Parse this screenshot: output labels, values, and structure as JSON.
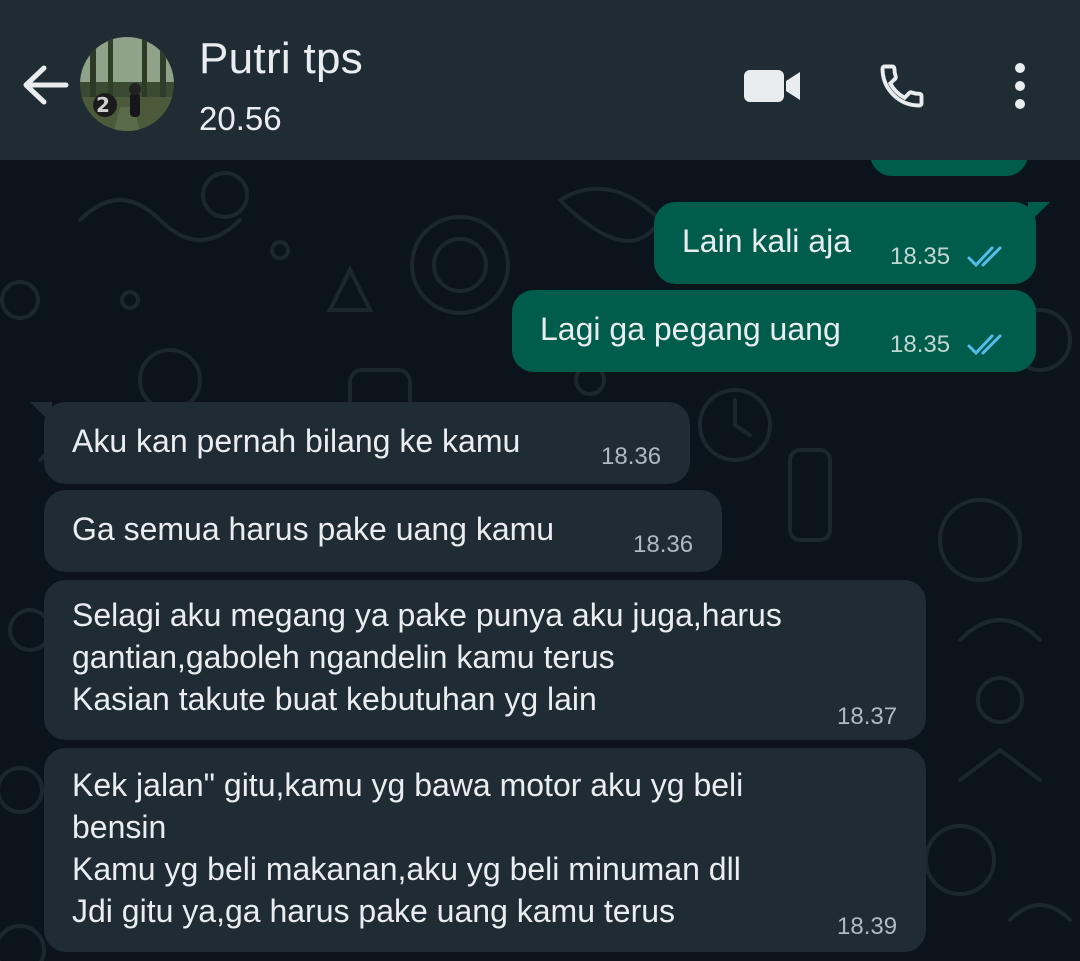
{
  "colors": {
    "header_bg": "#1f2c34",
    "chat_bg": "#0b141a",
    "outgoing_bubble": "#005c4b",
    "incoming_bubble": "#1f2c34",
    "read_ticks": "#53bdeb"
  },
  "header": {
    "contact_name": "Putri tps",
    "status": "20.56",
    "icons": [
      "back-arrow-icon",
      "avatar",
      "video-call-icon",
      "phone-icon",
      "more-vertical-icon"
    ]
  },
  "messages": [
    {
      "direction": "out",
      "text": "Lain kali aja",
      "time": "18.35",
      "status": "read"
    },
    {
      "direction": "out",
      "text": "Lagi ga pegang uang",
      "time": "18.35",
      "status": "read"
    },
    {
      "direction": "in",
      "text": "Aku kan pernah bilang ke kamu",
      "time": "18.36"
    },
    {
      "direction": "in",
      "text": "Ga semua harus pake uang kamu",
      "time": "18.36"
    },
    {
      "direction": "in",
      "text": "Selagi aku megang ya pake punya aku juga,harus\ngantian,gaboleh ngandelin kamu terus\nKasian takute buat kebutuhan yg lain",
      "time": "18.37"
    },
    {
      "direction": "in",
      "text": "Kek jalan\" gitu,kamu yg bawa motor aku yg beli\nbensin\nKamu yg beli makanan,aku yg beli minuman dll\nJdi gitu ya,ga harus pake uang kamu terus",
      "time": "18.39"
    }
  ]
}
